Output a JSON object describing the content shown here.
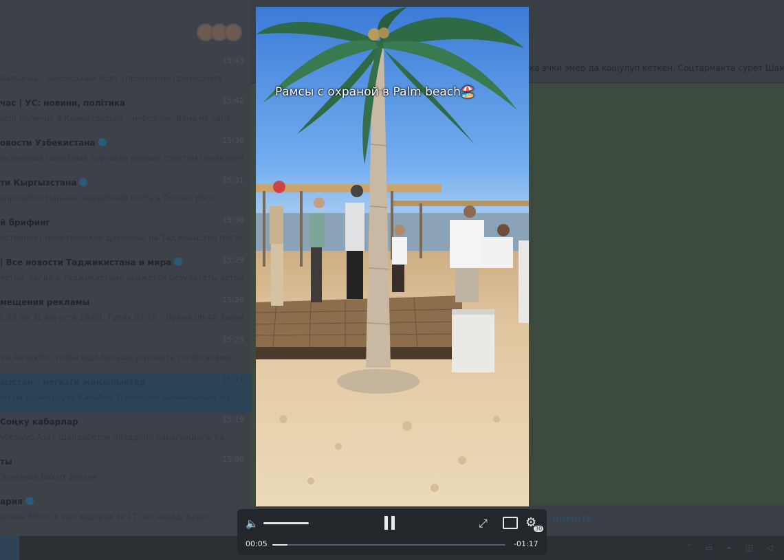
{
  "chat_list": [
    {
      "title": "",
      "time": "15:43",
      "preview": "Балыкчы – аймоосьний болт управлений президента",
      "verified": false,
      "active": false
    },
    {
      "title": "час | УС: новини, політика",
      "time": "15:42",
      "preview": "осій палений в Краматорську – небезпек. Вона не запо",
      "verified": false,
      "active": false
    },
    {
      "title": "овости Узбекистана",
      "time": "15:36",
      "preview": "экзаменов подобный торговля разных советом президента пр",
      "verified": true,
      "active": false
    },
    {
      "title": "ти Кыргызстана",
      "time": "15:31",
      "preview": "спроцессе Нарыны неудобный гость к Сосеен росс",
      "verified": true,
      "active": false
    },
    {
      "title": "й брифинг",
      "time": "15:30",
      "preview": "оставляет политическое давление на Таджикистан погаснет",
      "verified": false,
      "active": false
    },
    {
      "title": "| Все новости Таджикистана и мира",
      "time": "15:29",
      "preview": "естно, когда в Таджикистане окажется результаты встрече",
      "verified": true,
      "active": false
    },
    {
      "title": "мещения рекламы",
      "time": "15:26",
      "preview": "с 29 по 31 августа 18:00. Тупик 02:10 – Время 08:40 Звонки 12",
      "verified": false,
      "active": false
    },
    {
      "title": "",
      "time": "15:23",
      "preview": "ям Антикоп, чтобы ещё больше угрожать госорганами",
      "verified": false,
      "active": false
    },
    {
      "title": "ызстан – негизги жаңылыктар",
      "time": "15:21",
      "preview": "ин на башкаруучу Кальбек Туманбаев Балыкчынын жа",
      "verified": false,
      "active": true
    },
    {
      "title": "Соңку кабарлар",
      "time": "15:19",
      "preview": "убернур Азат Шабдабетов Instagram барагындагы ба",
      "verified": false,
      "active": false
    },
    {
      "title": "ты",
      "time": "15:06",
      "preview": "Эшманов Бахыт досым",
      "verified": false,
      "active": false
    },
    {
      "title": "ария",
      "time": "",
      "preview": "юзвик бетот в зем водорах за 17 час назад. Қарап",
      "verified": true,
      "active": false
    }
  ],
  "pinned_text": "ка эчки эмер да кошулуп кеткен. Соцтармакта сурет Шамалды",
  "unmute_label": "UNMUTE",
  "video": {
    "caption": "Рамсы  с охраной в Palm beach🏖️"
  },
  "player": {
    "current_time": "00:05",
    "remaining_time": "-01:17",
    "speed_badge": "30",
    "progress": 0.065,
    "volume": 0.85,
    "icons": [
      "volume-icon",
      "pause-icon",
      "fullscreen-icon",
      "picture-in-picture-icon",
      "settings-icon"
    ]
  }
}
